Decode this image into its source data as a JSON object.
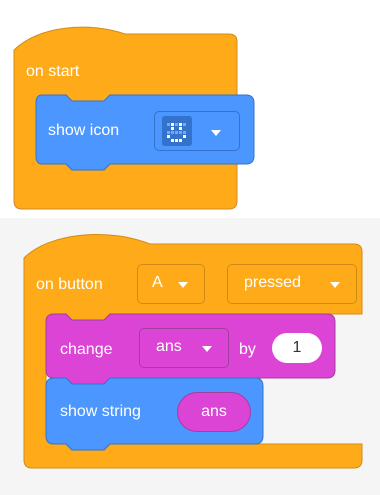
{
  "block1": {
    "hat_label": "on start",
    "command_label": "show icon"
  },
  "block2": {
    "hat_label": "on button",
    "button_value": "A",
    "event_value": "pressed",
    "change_label": "change",
    "variable_value": "ans",
    "by_label": "by",
    "by_value": "1",
    "show_string_label": "show string",
    "string_value": "ans"
  },
  "colors": {
    "events": "#FFAB19",
    "events_dark": "#CF8B17",
    "basic": "#4C97FF",
    "basic_dark": "#3373CC",
    "variables": "#DC44D6",
    "variables_dark": "#A33DA0"
  }
}
